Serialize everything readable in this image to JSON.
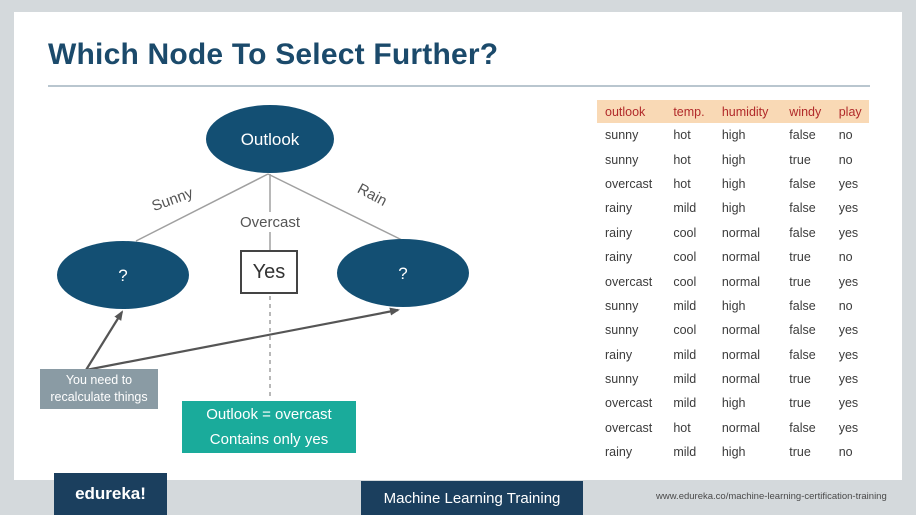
{
  "slide": {
    "title": "Which Node To Select Further?"
  },
  "tree": {
    "root": "Outlook",
    "left_node": "?",
    "right_node": "?",
    "edge_sunny": "Sunny",
    "edge_overcast": "Overcast",
    "edge_rain": "Rain",
    "overcast_leaf": "Yes",
    "note": {
      "line1": "You need to",
      "line2": "recalculate things"
    },
    "result": {
      "line1": "Outlook = overcast",
      "line2": "Contains only yes"
    }
  },
  "table": {
    "headers": [
      "outlook",
      "temp.",
      "humidity",
      "windy",
      "play"
    ],
    "rows": [
      [
        "sunny",
        "hot",
        "high",
        "false",
        "no"
      ],
      [
        "sunny",
        "hot",
        "high",
        "true",
        "no"
      ],
      [
        "overcast",
        "hot",
        "high",
        "false",
        "yes"
      ],
      [
        "rainy",
        "mild",
        "high",
        "false",
        "yes"
      ],
      [
        "rainy",
        "cool",
        "normal",
        "false",
        "yes"
      ],
      [
        "rainy",
        "cool",
        "normal",
        "true",
        "no"
      ],
      [
        "overcast",
        "cool",
        "normal",
        "true",
        "yes"
      ],
      [
        "sunny",
        "mild",
        "high",
        "false",
        "no"
      ],
      [
        "sunny",
        "cool",
        "normal",
        "false",
        "yes"
      ],
      [
        "rainy",
        "mild",
        "normal",
        "false",
        "yes"
      ],
      [
        "sunny",
        "mild",
        "normal",
        "true",
        "yes"
      ],
      [
        "overcast",
        "mild",
        "high",
        "true",
        "yes"
      ],
      [
        "overcast",
        "hot",
        "normal",
        "false",
        "yes"
      ],
      [
        "rainy",
        "mild",
        "high",
        "true",
        "no"
      ]
    ]
  },
  "footer": {
    "logo": "edureka!",
    "training": "Machine Learning Training",
    "url": "www.edureka.co/machine-learning-certification-training"
  },
  "colors": {
    "title": "#1b4a6b",
    "node_fill": "#134f73",
    "note_box": "#8a9ba4",
    "result_box": "#1aab9b",
    "table_header_bg": "#f9d9b5",
    "table_header_text": "#b12a2a",
    "footer_bg": "#1b3f5e"
  }
}
